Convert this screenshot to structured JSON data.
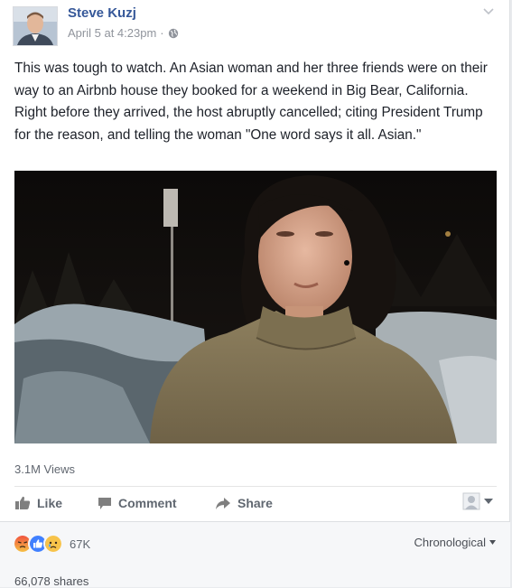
{
  "post": {
    "author": "Steve Kuzj",
    "timestamp": "April 5 at 4:23pm",
    "meta_separator": "·",
    "audience_icon": "globe-icon",
    "text": "This was tough to watch. An Asian woman and her three friends were on their way to an Airbnb house they booked for a weekend in Big Bear, California. Right before they arrived, the host abruptly cancelled; citing President Trump for the reason, and telling the woman \"One word says it all. Asian.\"",
    "views": "3.1M Views"
  },
  "actions": {
    "like": "Like",
    "comment": "Comment",
    "share": "Share"
  },
  "reactions": {
    "icons": [
      "angry-reaction-icon",
      "like-reaction-icon",
      "sad-reaction-icon"
    ],
    "count": "67K"
  },
  "sort": {
    "selected": "Chronological"
  },
  "shares": "66,078 shares",
  "colors": {
    "link": "#365899",
    "like_blue": "#4080ff",
    "angry": "#f0533e",
    "sad": "#f7c34a"
  }
}
